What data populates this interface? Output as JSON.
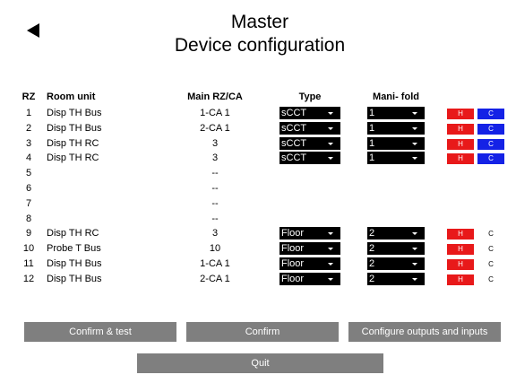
{
  "title": {
    "line1": "Master",
    "line2": "Device configuration"
  },
  "headers": {
    "rz": "RZ",
    "room_unit": "Room unit",
    "main": "Main RZ/CA",
    "type": "Type",
    "manifold": "Mani- fold"
  },
  "rows": [
    {
      "rz": "1",
      "room": "Disp TH Bus",
      "main": "1-CA 1",
      "type": "sCCT",
      "manifold": "1",
      "h": "H",
      "c": "C",
      "c_active": true
    },
    {
      "rz": "2",
      "room": "Disp TH Bus",
      "main": "2-CA 1",
      "type": "sCCT",
      "manifold": "1",
      "h": "H",
      "c": "C",
      "c_active": true
    },
    {
      "rz": "3",
      "room": "Disp TH RC",
      "main": "3",
      "type": "sCCT",
      "manifold": "1",
      "h": "H",
      "c": "C",
      "c_active": true
    },
    {
      "rz": "4",
      "room": "Disp TH RC",
      "main": "3",
      "type": "sCCT",
      "manifold": "1",
      "h": "H",
      "c": "C",
      "c_active": true
    },
    {
      "rz": "5",
      "room": "",
      "main": "--",
      "type": null,
      "manifold": null,
      "h": null,
      "c": null,
      "c_active": false
    },
    {
      "rz": "6",
      "room": "",
      "main": "--",
      "type": null,
      "manifold": null,
      "h": null,
      "c": null,
      "c_active": false
    },
    {
      "rz": "7",
      "room": "",
      "main": "--",
      "type": null,
      "manifold": null,
      "h": null,
      "c": null,
      "c_active": false
    },
    {
      "rz": "8",
      "room": "",
      "main": "--",
      "type": null,
      "manifold": null,
      "h": null,
      "c": null,
      "c_active": false
    },
    {
      "rz": "9",
      "room": "Disp TH RC",
      "main": "3",
      "type": "Floor",
      "manifold": "2",
      "h": "H",
      "c": "C",
      "c_active": false
    },
    {
      "rz": "10",
      "room": "Probe T Bus",
      "main": "10",
      "type": "Floor",
      "manifold": "2",
      "h": "H",
      "c": "C",
      "c_active": false
    },
    {
      "rz": "11",
      "room": "Disp TH Bus",
      "main": "1-CA 1",
      "type": "Floor",
      "manifold": "2",
      "h": "H",
      "c": "C",
      "c_active": false
    },
    {
      "rz": "12",
      "room": "Disp TH Bus",
      "main": "2-CA 1",
      "type": "Floor",
      "manifold": "2",
      "h": "H",
      "c": "C",
      "c_active": false
    }
  ],
  "buttons": {
    "confirm_test": "Confirm & test",
    "confirm": "Confirm",
    "configure": "Configure outputs and inputs",
    "quit": "Quit"
  },
  "colors": {
    "heat": "#e8191a",
    "cool": "#1422e6",
    "button": "#7f7f7f"
  },
  "icons": {
    "back": "back-arrow-icon",
    "dropdown": "caret-down-icon"
  }
}
